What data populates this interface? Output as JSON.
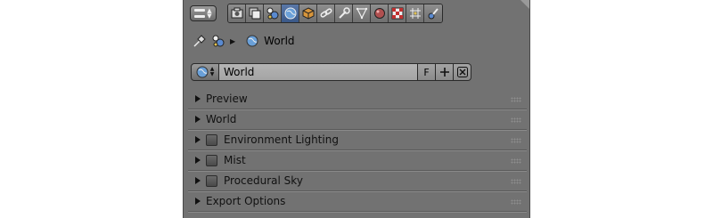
{
  "toolbar": {
    "editor_icon": "properties-editor-icon",
    "context_icons": [
      "render-icon",
      "render-layers-icon",
      "scene-icon",
      "world-icon",
      "object-icon",
      "constraints-icon",
      "modifiers-icon",
      "data-icon",
      "material-icon",
      "texture-icon",
      "particles-icon",
      "physics-icon"
    ],
    "active_context": "world-icon"
  },
  "breadcrumb": {
    "pin_icon": "pin-icon",
    "scene_icon": "scene-icon",
    "label": "World"
  },
  "datablock": {
    "name": "World",
    "fake_user_label": "F",
    "new_icon": "plus-icon",
    "unlink_icon": "close-icon"
  },
  "panels": [
    {
      "label": "Preview",
      "has_checkbox": false
    },
    {
      "label": "World",
      "has_checkbox": false
    },
    {
      "label": "Environment Lighting",
      "has_checkbox": true
    },
    {
      "label": "Mist",
      "has_checkbox": true
    },
    {
      "label": "Procedural Sky",
      "has_checkbox": true
    },
    {
      "label": "Export Options",
      "has_checkbox": false
    }
  ],
  "colors": {
    "panel_bg": "#727272",
    "active_tab": "#4a6898",
    "field_bg": "#aaaaaa"
  }
}
